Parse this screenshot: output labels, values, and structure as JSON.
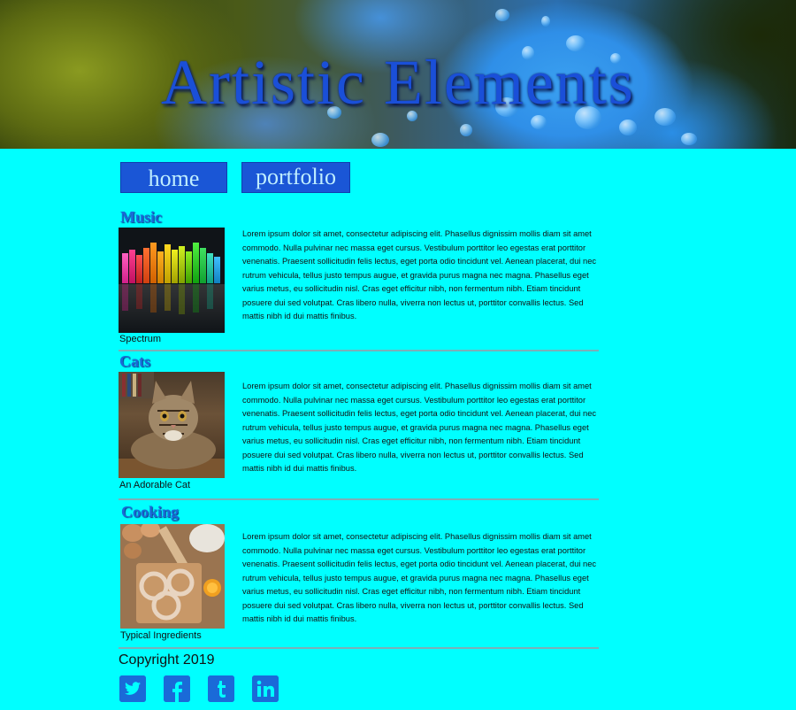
{
  "header": {
    "title": "Artistic Elements"
  },
  "nav": {
    "home": "home",
    "portfolio": "portfolio"
  },
  "sections": [
    {
      "title": "Music",
      "caption": "Spectrum",
      "text": "Lorem ipsum dolor sit amet, consectetur adipiscing elit. Phasellus dignissim mollis diam sit amet commodo. Nulla pulvinar nec massa eget cursus. Vestibulum porttitor leo egestas erat porttitor venenatis. Praesent sollicitudin felis lectus, eget porta odio tincidunt vel. Aenean placerat, dui nec rutrum vehicula, tellus justo tempus augue, et gravida purus magna nec magna. Phasellus eget varius metus, eu sollicitudin nisl. Cras eget efficitur nibh, non fermentum nibh. Etiam tincidunt posuere dui sed volutpat. Cras libero nulla, viverra non lectus ut, porttitor convallis lectus. Sed mattis nibh id dui mattis finibus."
    },
    {
      "title": "Cats",
      "caption": "An Adorable Cat",
      "text": "Lorem ipsum dolor sit amet, consectetur adipiscing elit. Phasellus dignissim mollis diam sit amet commodo. Nulla pulvinar nec massa eget cursus. Vestibulum porttitor leo egestas erat porttitor venenatis. Praesent sollicitudin felis lectus, eget porta odio tincidunt vel. Aenean placerat, dui nec rutrum vehicula, tellus justo tempus augue, et gravida purus magna nec magna. Phasellus eget varius metus, eu sollicitudin nisl. Cras eget efficitur nibh, non fermentum nibh. Etiam tincidunt posuere dui sed volutpat. Cras libero nulla, viverra non lectus ut, porttitor convallis lectus. Sed mattis nibh id dui mattis finibus."
    },
    {
      "title": "Cooking",
      "caption": "Typical Ingredients",
      "text": "Lorem ipsum dolor sit amet, consectetur adipiscing elit. Phasellus dignissim mollis diam sit amet commodo. Nulla pulvinar nec massa eget cursus. Vestibulum porttitor leo egestas erat porttitor venenatis. Praesent sollicitudin felis lectus, eget porta odio tincidunt vel. Aenean placerat, dui nec rutrum vehicula, tellus justo tempus augue, et gravida purus magna nec magna. Phasellus eget varius metus, eu sollicitudin nisl. Cras eget efficitur nibh, non fermentum nibh. Etiam tincidunt posuere dui sed volutpat. Cras libero nulla, viverra non lectus ut, porttitor convallis lectus. Sed mattis nibh id dui mattis finibus."
    }
  ],
  "footer": {
    "copyright": "Copyright 2019",
    "social_icons": [
      "twitter-icon",
      "facebook-icon",
      "tumblr-icon",
      "linkedin-icon"
    ]
  },
  "colors": {
    "background": "#00ffff",
    "accent": "#1a56d6",
    "title": "#1a6ad8"
  }
}
